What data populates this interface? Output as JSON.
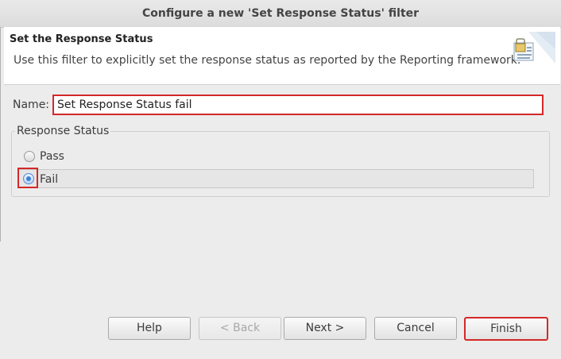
{
  "window": {
    "title": "Configure a new 'Set Response Status' filter"
  },
  "banner": {
    "title": "Set the Response Status",
    "description": "Use this filter to explicitly set the response status as reported by the Reporting framework.",
    "icon": "filter-config-icon"
  },
  "form": {
    "name_label": "Name:",
    "name_value": "Set Response Status fail"
  },
  "response_status": {
    "legend": "Response Status",
    "options": [
      {
        "label": "Pass",
        "checked": false
      },
      {
        "label": "Fail",
        "checked": true
      }
    ]
  },
  "buttons": {
    "help": "Help",
    "back": "< Back",
    "next": "Next >",
    "cancel": "Cancel",
    "finish": "Finish"
  },
  "colors": {
    "highlight": "#d42828",
    "radio_selected": "#3d7fd6"
  }
}
